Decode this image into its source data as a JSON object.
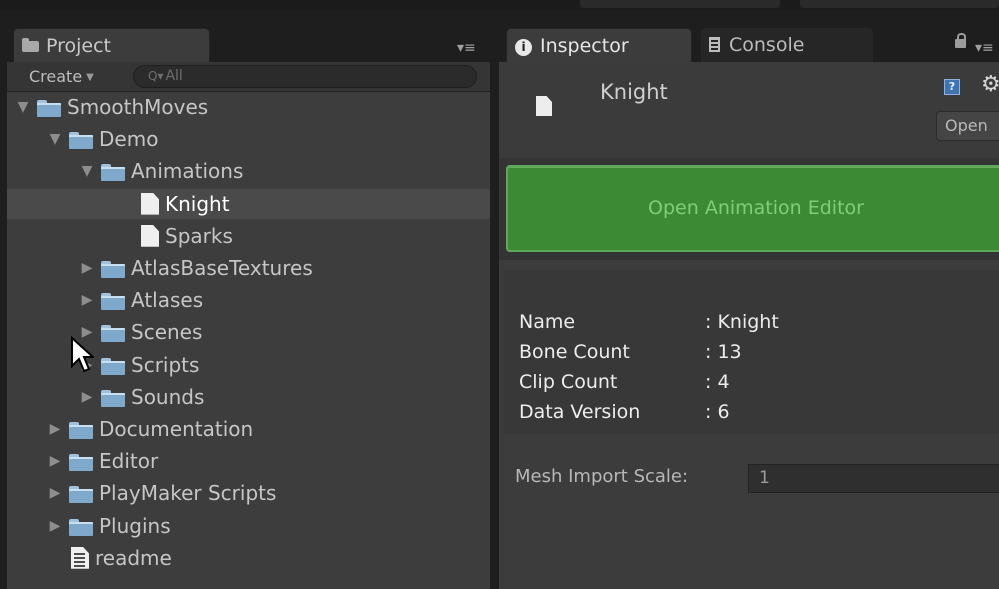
{
  "project_panel": {
    "tab_label": "Project",
    "menu_glyph": "▾≡",
    "toolbar": {
      "create_label": "Create",
      "create_caret": "▼",
      "search_placeholder": "All",
      "search_icon": "Q▾"
    },
    "tree": [
      {
        "label": "SmoothMoves",
        "kind": "folder",
        "depth": 0,
        "expanded": true
      },
      {
        "label": "Demo",
        "kind": "folder",
        "depth": 1,
        "expanded": true
      },
      {
        "label": "Animations",
        "kind": "folder",
        "depth": 2,
        "expanded": true
      },
      {
        "label": "Knight",
        "kind": "file",
        "depth": 3,
        "selected": true
      },
      {
        "label": "Sparks",
        "kind": "file",
        "depth": 3
      },
      {
        "label": "AtlasBaseTextures",
        "kind": "folder",
        "depth": 2,
        "expanded": false
      },
      {
        "label": "Atlases",
        "kind": "folder",
        "depth": 2,
        "expanded": false
      },
      {
        "label": "Scenes",
        "kind": "folder",
        "depth": 2,
        "expanded": false
      },
      {
        "label": "Scripts",
        "kind": "folder",
        "depth": 2,
        "expanded": false
      },
      {
        "label": "Sounds",
        "kind": "folder",
        "depth": 2,
        "expanded": false
      },
      {
        "label": "Documentation",
        "kind": "folder",
        "depth": 1,
        "expanded": false
      },
      {
        "label": "Editor",
        "kind": "folder",
        "depth": 1,
        "expanded": false
      },
      {
        "label": "PlayMaker Scripts",
        "kind": "folder",
        "depth": 1,
        "expanded": false
      },
      {
        "label": "Plugins",
        "kind": "folder",
        "depth": 1,
        "expanded": false
      },
      {
        "label": "readme",
        "kind": "text-file",
        "depth": 1
      }
    ]
  },
  "inspector_panel": {
    "tab_label": "Inspector",
    "console_tab_label": "Console",
    "menu_glyph": "▾≡",
    "asset_name": "Knight",
    "help_glyph": "?",
    "gear_glyph": "⚙",
    "open_button_label": "Open",
    "open_editor_button_label": "Open Animation Editor",
    "info": [
      {
        "key": "Name",
        "value": ": Knight"
      },
      {
        "key": "Bone Count",
        "value": ": 13"
      },
      {
        "key": "Clip Count",
        "value": ": 4"
      },
      {
        "key": "Data Version",
        "value": ": 6"
      }
    ],
    "mesh_import_scale_label": "Mesh Import Scale:",
    "mesh_import_scale_value": "1"
  },
  "colors": {
    "panel_bg": "#3c3c3c",
    "selection_bg": "#4a4a4a",
    "accent_green": "#3d8a35",
    "folder_blue": "#7ea9cb"
  }
}
